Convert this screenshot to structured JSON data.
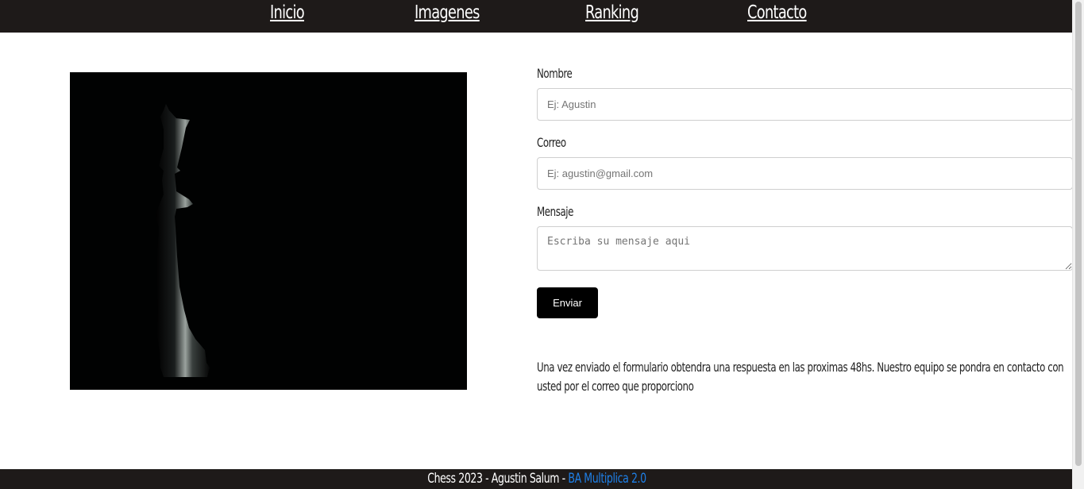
{
  "nav": {
    "items": [
      {
        "label": "Inicio"
      },
      {
        "label": "Imagenes"
      },
      {
        "label": "Ranking"
      },
      {
        "label": "Contacto"
      }
    ]
  },
  "image": {
    "icon": "chess-queen-icon"
  },
  "form": {
    "name_label": "Nombre",
    "name_placeholder": "Ej: Agustin",
    "email_label": "Correo",
    "email_placeholder": "Ej: agustin@gmail.com",
    "message_label": "Mensaje",
    "message_placeholder": "Escriba su mensaje aqui",
    "submit_label": "Enviar"
  },
  "info": {
    "text": "Una vez enviado el formulario obtendra una respuesta en las proximas 48hs. Nuestro equipo se pondra en contacto con usted por el correo que proporciono"
  },
  "footer": {
    "text": "Chess 2023 - Agustin Salum - ",
    "link_label": "BA Multiplica 2.0"
  },
  "colors": {
    "navbar_bg": "#1e1a19",
    "button_bg": "#000000",
    "footer_link": "#1e7fe6"
  }
}
